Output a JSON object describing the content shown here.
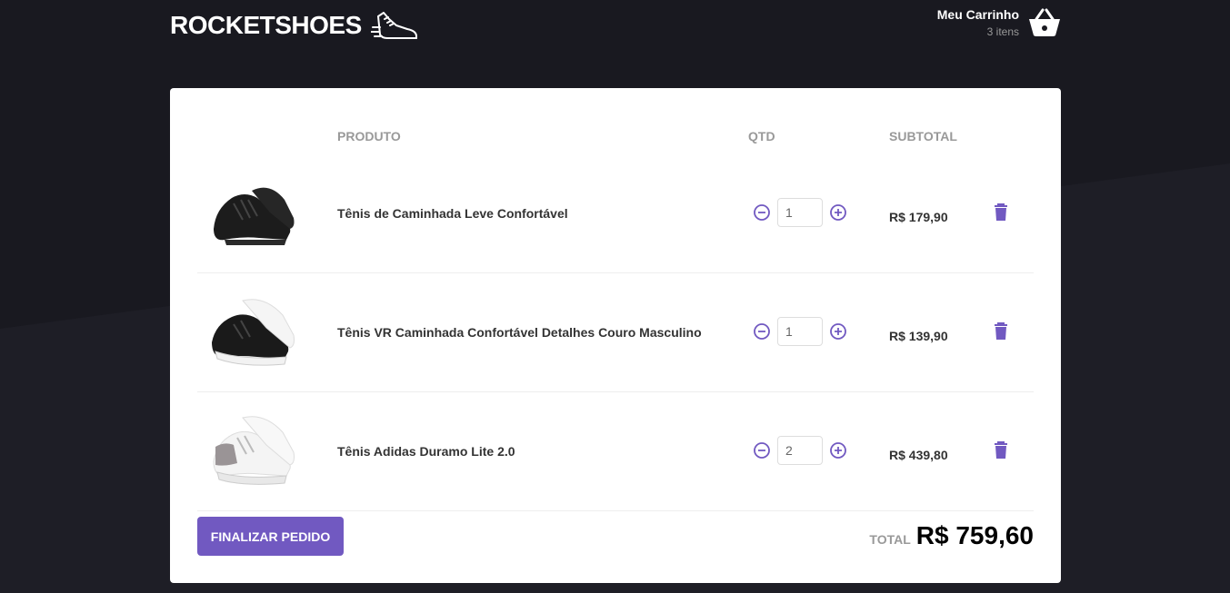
{
  "header": {
    "logo_text": "ROCKETSHOES",
    "logo_icon": "sneaker-icon",
    "cart_title": "Meu Carrinho",
    "cart_count": "3 itens",
    "cart_icon": "basket-icon"
  },
  "table": {
    "col_product": "PRODUTO",
    "col_qty": "QTD",
    "col_subtotal": "SUBTOTAL"
  },
  "items": [
    {
      "name": "Tênis de Caminhada Leve Confortável",
      "qty": "1",
      "subtotal": "R$ 179,90",
      "image": "black-sneaker"
    },
    {
      "name": "Tênis VR Caminhada Confortável Detalhes Couro Masculino",
      "qty": "1",
      "subtotal": "R$ 139,90",
      "image": "black-white-sneaker"
    },
    {
      "name": "Tênis Adidas Duramo Lite 2.0",
      "qty": "2",
      "subtotal": "R$ 439,80",
      "image": "white-grey-sneaker"
    }
  ],
  "footer": {
    "checkout_label": "FINALIZAR PEDIDO",
    "total_label": "TOTAL",
    "total_value": "R$ 759,60"
  },
  "colors": {
    "background": "#191920",
    "accent": "#7159c1",
    "panel": "#ffffff"
  }
}
